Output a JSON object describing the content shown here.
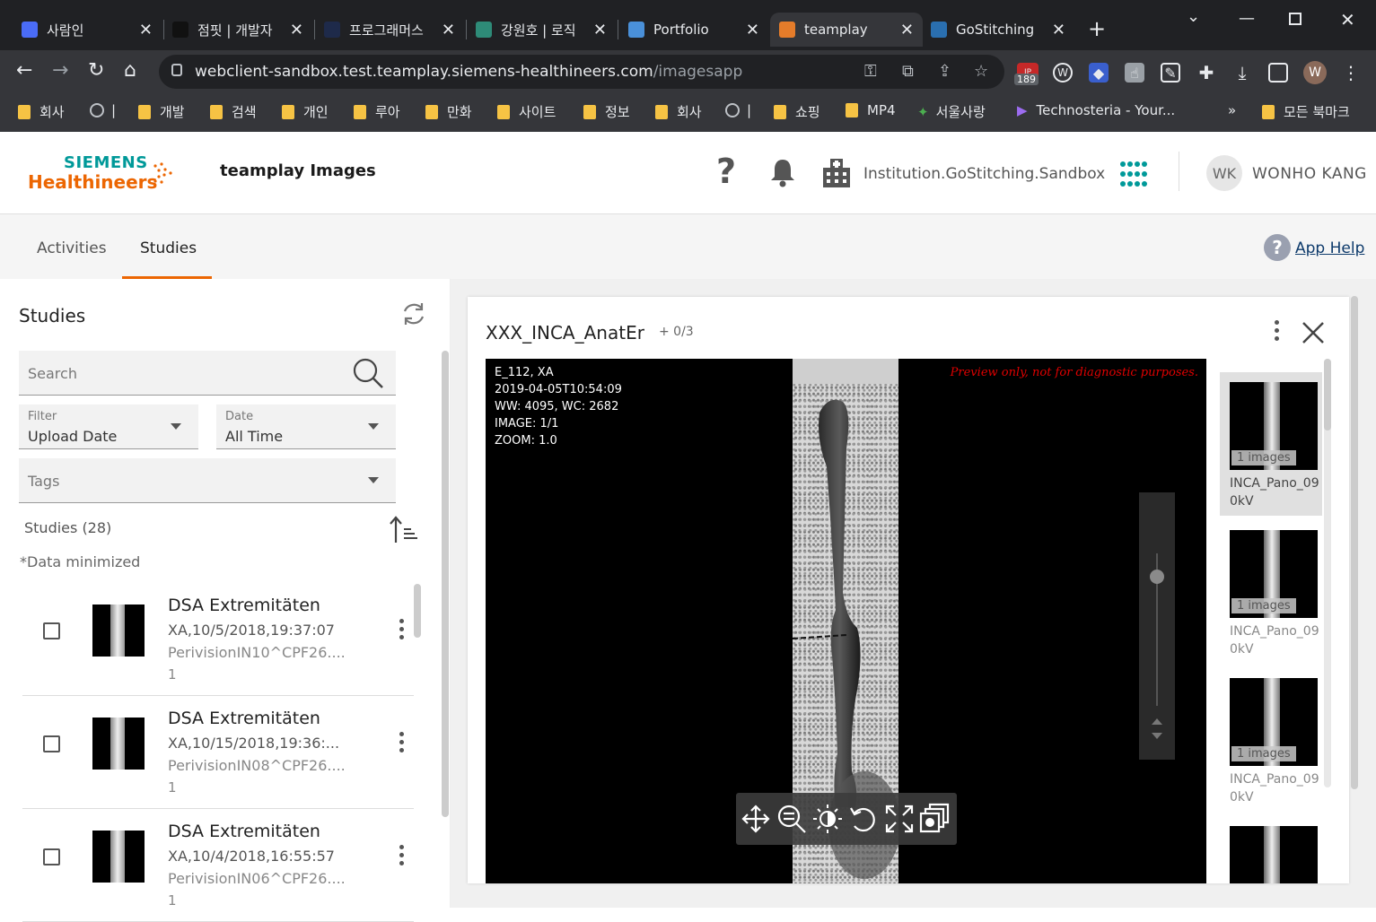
{
  "browser": {
    "tabs": [
      {
        "title": "사람인",
        "favicon": "saramin-icon",
        "color": "#4a6cf7"
      },
      {
        "title": "점핏 | 개발자",
        "favicon": "jumpit-icon",
        "color": "#111111"
      },
      {
        "title": "프로그래머스",
        "favicon": "programmers-icon",
        "color": "#1e2a4a"
      },
      {
        "title": "강원호 | 로직",
        "favicon": "logic-icon",
        "color": "#2e8b78"
      },
      {
        "title": "Portfolio",
        "favicon": "folder-icon",
        "color": "#4a90d9"
      },
      {
        "title": "teamplay",
        "favicon": "teamplay-icon",
        "color": "#e57c2a"
      },
      {
        "title": "GoStitching",
        "favicon": "gostitching-icon",
        "color": "#2a6fb0"
      }
    ],
    "active_tab": 5,
    "new_tab": "+",
    "url_host": "webclient-sandbox.test.teamplay.siemens-healthineers.com",
    "url_path": "/imagesapp",
    "ext_badge": "189",
    "profile_initial": "W",
    "bookmarks": [
      {
        "label": "회사",
        "icon": "folder"
      },
      {
        "label": "|",
        "icon": "globe"
      },
      {
        "label": "개발",
        "icon": "folder"
      },
      {
        "label": "검색",
        "icon": "folder"
      },
      {
        "label": "개인",
        "icon": "folder"
      },
      {
        "label": "루아",
        "icon": "folder"
      },
      {
        "label": "만화",
        "icon": "folder"
      },
      {
        "label": "사이트",
        "icon": "folder"
      },
      {
        "label": "정보",
        "icon": "folder"
      },
      {
        "label": "회사",
        "icon": "folder"
      },
      {
        "label": "|",
        "icon": "globe"
      },
      {
        "label": "쇼핑",
        "icon": "folder"
      },
      {
        "label": "MP4",
        "icon": "folder"
      },
      {
        "label": "서울사랑",
        "icon": "seoul"
      },
      {
        "label": "Technosteria - Your...",
        "icon": "play"
      }
    ],
    "bookmarks_more": "»",
    "all_bookmarks": "모든 북마크"
  },
  "header": {
    "logo_top": "SIEMENS",
    "logo_bottom": "Healthineers",
    "app_title": "teamplay Images",
    "help": "?",
    "institution": "Institution.GoStitching.Sandbox",
    "user_initials": "WK",
    "user_name": "WONHO KANG"
  },
  "nav": {
    "tabs": [
      "Activities",
      "Studies"
    ],
    "active": "Studies",
    "app_help": "App Help"
  },
  "studies_panel": {
    "heading": "Studies",
    "search_placeholder": "Search",
    "filter_label": "Filter",
    "filter_value": "Upload Date",
    "date_label": "Date",
    "date_value": "All Time",
    "tags_placeholder": "Tags",
    "count": "Studies (28)",
    "data_minimized": "*Data minimized",
    "items": [
      {
        "title": "DSA Extremitäten",
        "line2": "XA,10/5/2018,19:37:07",
        "line3": "PerivisionIN10^CPF26....",
        "line4": "1"
      },
      {
        "title": "DSA Extremitäten",
        "line2": "XA,10/15/2018,19:36:...",
        "line3": "PerivisionIN08^CPF26....",
        "line4": "1"
      },
      {
        "title": "DSA Extremitäten",
        "line2": "XA,10/4/2018,16:55:57",
        "line3": "PerivisionIN06^CPF26....",
        "line4": "1"
      }
    ]
  },
  "viewer": {
    "series_title": "XXX_INCA_AnatEr",
    "series_count": "+ 0/3",
    "overlay": [
      "E_112, XA",
      "2019-04-05T10:54:09",
      "WW: 4095, WC: 2682",
      "IMAGE: 1/1",
      "ZOOM: 1.0"
    ],
    "preview_warning": "Preview only, not for diagnostic purposes.",
    "zoom_level": 0.85,
    "tools": [
      "pan-icon",
      "zoom-icon",
      "contrast-icon",
      "reset-icon",
      "fullscreen-icon",
      "stack-icon"
    ],
    "thumbnails": [
      {
        "badge": "1 images",
        "name": "INCA_Pano_090kV",
        "selected": true
      },
      {
        "badge": "1 images",
        "name": "INCA_Pano_090kV",
        "selected": false
      },
      {
        "badge": "1 images",
        "name": "INCA_Pano_090kV",
        "selected": false
      },
      {
        "badge": "",
        "name": "",
        "selected": false
      }
    ]
  },
  "colors": {
    "accent": "#ec6602",
    "siemens_teal": "#009999",
    "warning": "#e00000"
  }
}
